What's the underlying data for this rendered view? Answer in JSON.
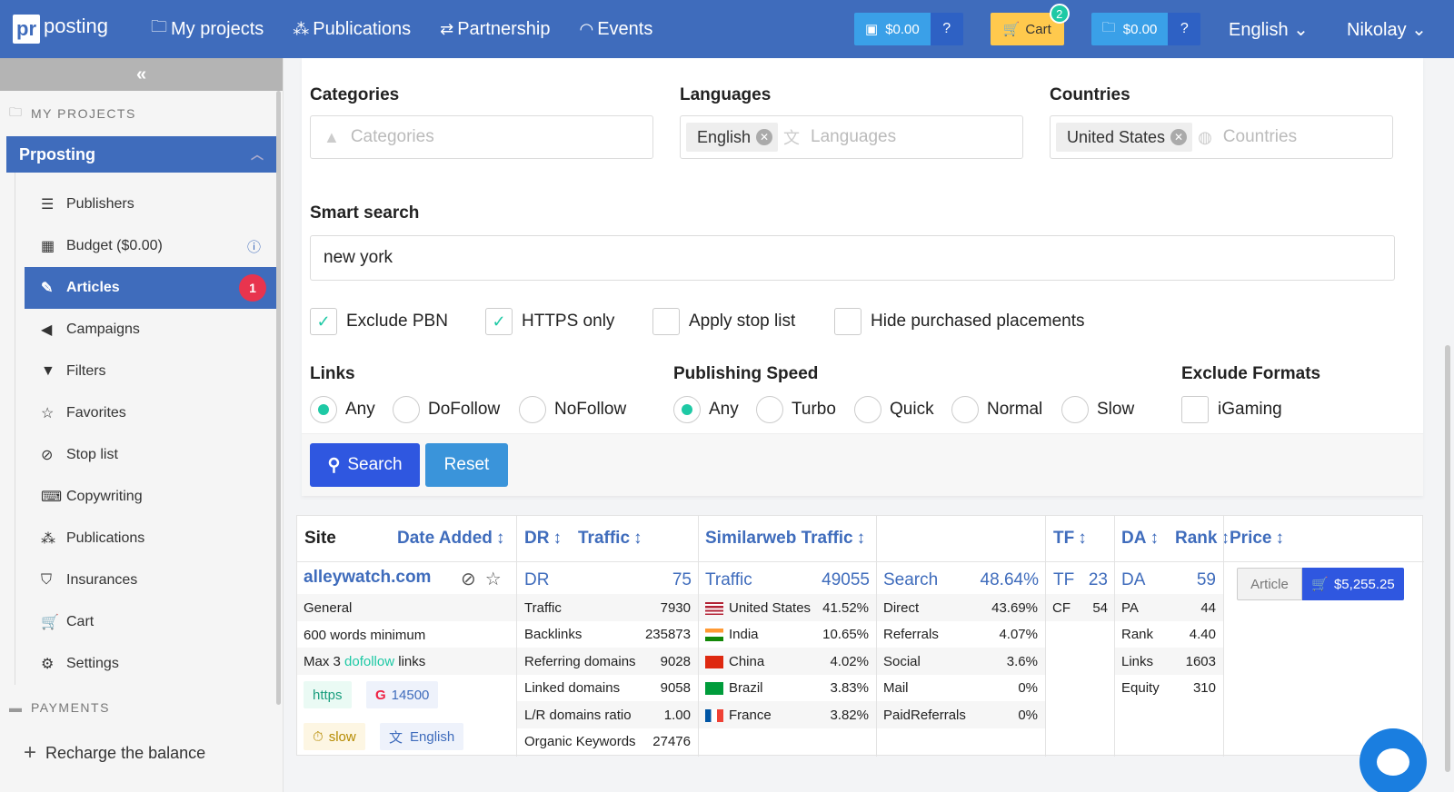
{
  "header": {
    "logo_box": "pr",
    "logo_text": "posting",
    "nav": [
      {
        "label": "My projects",
        "icon": "folder-icon"
      },
      {
        "label": "Publications",
        "icon": "network-icon"
      },
      {
        "label": "Partnership",
        "icon": "handshake-icon"
      },
      {
        "label": "Events",
        "icon": "rss-icon"
      }
    ],
    "balance1": "$0.00",
    "cart_label": "Cart",
    "cart_count": "2",
    "balance2": "$0.00",
    "language": "English",
    "user": "Nikolay"
  },
  "sidebar": {
    "collapse": "«",
    "section1": "MY PROJECTS",
    "project": "Prposting",
    "items": [
      {
        "label": "Publishers",
        "icon": "list-icon",
        "glyph": "☰"
      },
      {
        "label": "Budget ($0.00)",
        "icon": "calculator-icon",
        "glyph": "▦"
      },
      {
        "label": "Articles",
        "icon": "pencil-icon",
        "glyph": "✎",
        "badge": "1"
      },
      {
        "label": "Campaigns",
        "icon": "megaphone-icon",
        "glyph": "📢"
      },
      {
        "label": "Filters",
        "icon": "filter-icon",
        "glyph": "▼"
      },
      {
        "label": "Favorites",
        "icon": "star-icon",
        "glyph": "☆"
      },
      {
        "label": "Stop list",
        "icon": "ban-icon",
        "glyph": "⊘"
      },
      {
        "label": "Copywriting",
        "icon": "keyboard-icon",
        "glyph": "⌨"
      },
      {
        "label": "Publications",
        "icon": "network-icon",
        "glyph": "⁂"
      },
      {
        "label": "Insurances",
        "icon": "shield-icon",
        "glyph": "⛉"
      },
      {
        "label": "Cart",
        "icon": "cart-icon",
        "glyph": "🛒"
      },
      {
        "label": "Settings",
        "icon": "gears-icon",
        "glyph": "⚙"
      }
    ],
    "section2": "PAYMENTS",
    "recharge": "Recharge the balance"
  },
  "filters": {
    "categories_label": "Categories",
    "categories_placeholder": "Categories",
    "languages_label": "Languages",
    "languages_chip": "English",
    "languages_placeholder": "Languages",
    "countries_label": "Countries",
    "countries_chip": "United States",
    "countries_placeholder": "Countries",
    "smart_label": "Smart search",
    "smart_value": "new york",
    "checks": [
      {
        "label": "Exclude PBN",
        "checked": true
      },
      {
        "label": "HTTPS only",
        "checked": true
      },
      {
        "label": "Apply stop list",
        "checked": false
      },
      {
        "label": "Hide purchased placements",
        "checked": false
      }
    ],
    "links_label": "Links",
    "links_options": [
      "Any",
      "DoFollow",
      "NoFollow"
    ],
    "speed_label": "Publishing Speed",
    "speed_options": [
      "Any",
      "Turbo",
      "Quick",
      "Normal",
      "Slow"
    ],
    "exclude_label": "Exclude Formats",
    "exclude_option": "iGaming",
    "search_btn": "Search",
    "reset_btn": "Reset"
  },
  "table": {
    "headers": {
      "site": "Site",
      "date_added": "Date Added",
      "dr": "DR",
      "traffic": "Traffic",
      "similarweb": "Similarweb Traffic",
      "tf": "TF",
      "da": "DA",
      "rank": "Rank",
      "price": "Price"
    },
    "row": {
      "site": "alleywatch.com",
      "site_info": [
        {
          "text": "General"
        },
        {
          "text": "600 words minimum"
        }
      ],
      "links_pre": "Max 3 ",
      "links_mid": "dofollow",
      "links_post": " links",
      "tag_https": "https",
      "tag_google": "14500",
      "tag_speed": "slow",
      "tag_lang": "English",
      "dr_label": "DR",
      "dr_value": "75",
      "dr_stats": [
        {
          "k": "Traffic",
          "v": "7930"
        },
        {
          "k": "Backlinks",
          "v": "235873"
        },
        {
          "k": "Referring domains",
          "v": "9028"
        },
        {
          "k": "Linked domains",
          "v": "9058"
        },
        {
          "k": "L/R domains ratio",
          "v": "1.00"
        },
        {
          "k": "Organic Keywords",
          "v": "27476"
        }
      ],
      "traffic_label": "Traffic",
      "traffic_value": "49055",
      "countries": [
        {
          "k": "United States",
          "v": "41.52%",
          "flag": "us"
        },
        {
          "k": "India",
          "v": "10.65%",
          "flag": "in"
        },
        {
          "k": "China",
          "v": "4.02%",
          "flag": "cn"
        },
        {
          "k": "Brazil",
          "v": "3.83%",
          "flag": "br"
        },
        {
          "k": "France",
          "v": "3.82%",
          "flag": "fr"
        }
      ],
      "search_label": "Search",
      "search_value": "48.64%",
      "sources": [
        {
          "k": "Direct",
          "v": "43.69%"
        },
        {
          "k": "Referrals",
          "v": "4.07%"
        },
        {
          "k": "Social",
          "v": "3.6%"
        },
        {
          "k": "Mail",
          "v": "0%"
        },
        {
          "k": "PaidReferrals",
          "v": "0%"
        }
      ],
      "tf_label": "TF",
      "tf_value": "23",
      "cf_label": "CF",
      "cf_value": "54",
      "da_label": "DA",
      "da_value": "59",
      "da_stats": [
        {
          "k": "PA",
          "v": "44"
        },
        {
          "k": "Rank",
          "v": "4.40"
        },
        {
          "k": "Links",
          "v": "1603"
        },
        {
          "k": "Equity",
          "v": "310"
        }
      ],
      "article_btn": "Article",
      "price_btn": "$5,255.25"
    }
  },
  "colors": {
    "brand": "#3f6cbc",
    "accent": "#1ec9a5",
    "primary_btn": "#2f57e0",
    "cart": "#ffc94d"
  }
}
